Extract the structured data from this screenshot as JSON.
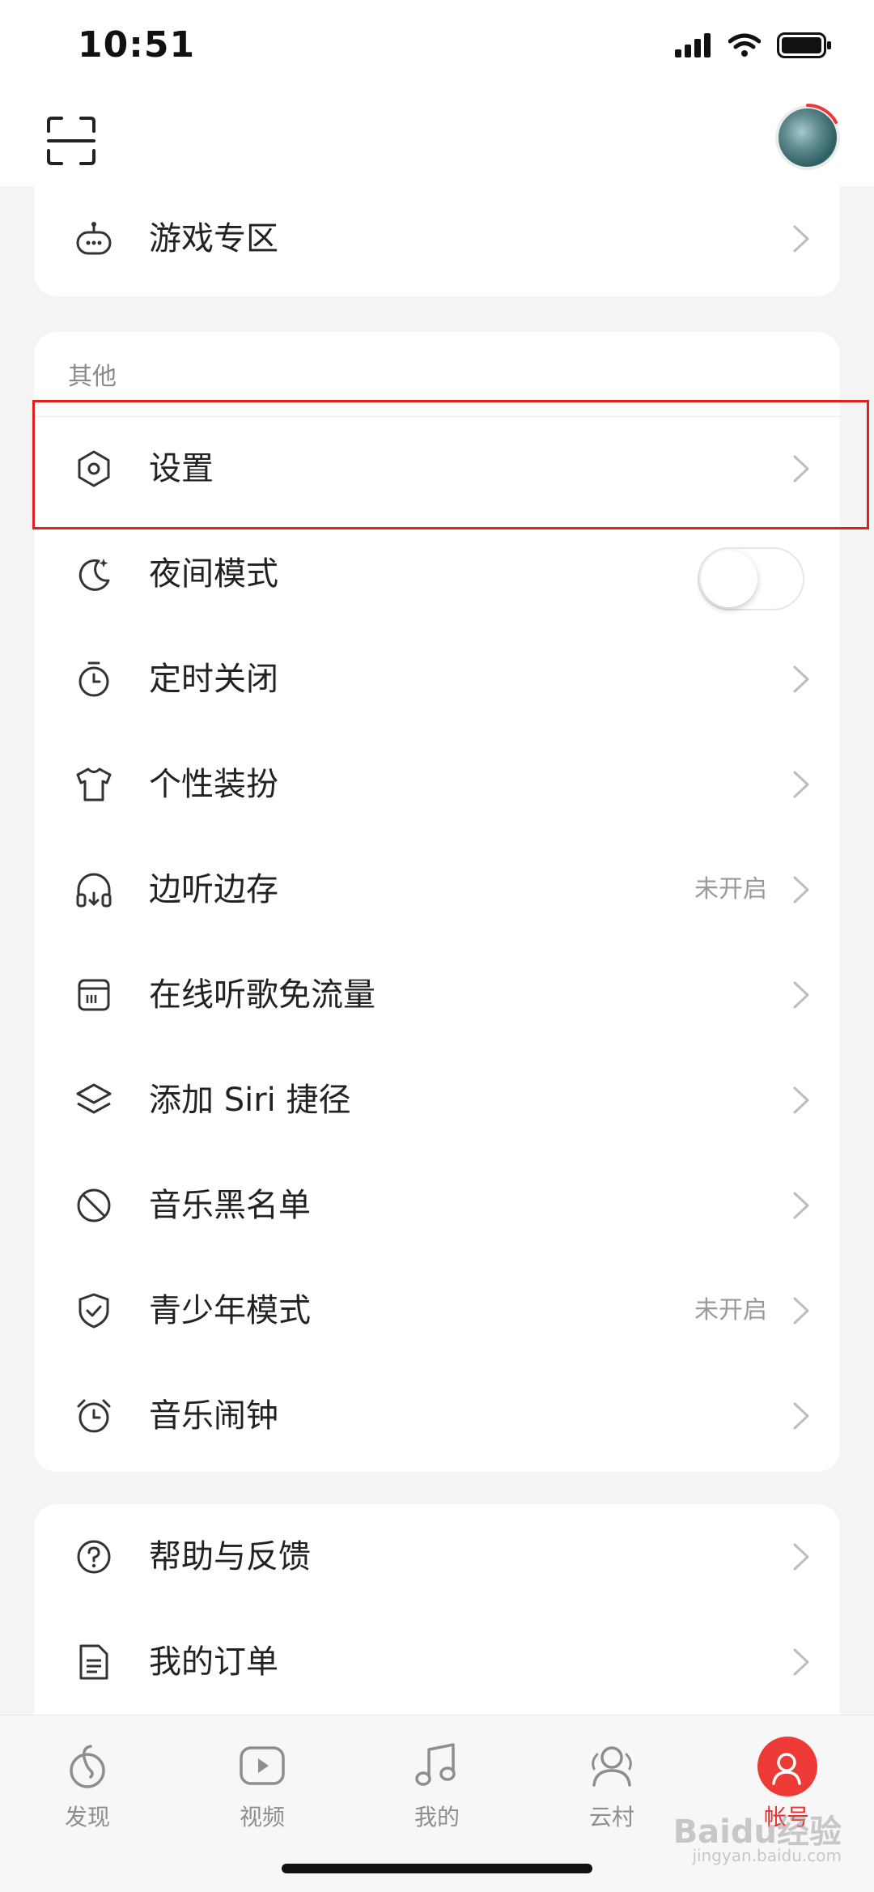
{
  "status_bar": {
    "time": "10:51"
  },
  "top_bar": {
    "scan_icon": "scan-icon",
    "avatar_icon": "avatar"
  },
  "card_top": {
    "items": [
      {
        "label": "游戏专区",
        "icon": "gamepad-icon"
      }
    ]
  },
  "other_section": {
    "title": "其他",
    "items": [
      {
        "label": "设置",
        "icon": "hexagon-settings-icon"
      },
      {
        "label": "夜间模式",
        "icon": "moon-icon",
        "toggle_on": false
      },
      {
        "label": "定时关闭",
        "icon": "timer-icon"
      },
      {
        "label": "个性装扮",
        "icon": "tshirt-icon"
      },
      {
        "label": "边听边存",
        "icon": "headphones-icon",
        "extra": "未开启"
      },
      {
        "label": "在线听歌免流量",
        "icon": "sim-card-icon"
      },
      {
        "label": "添加 Siri 捷径",
        "icon": "layers-icon"
      },
      {
        "label": "音乐黑名单",
        "icon": "block-icon"
      },
      {
        "label": "青少年模式",
        "icon": "shield-check-icon",
        "extra": "未开启"
      },
      {
        "label": "音乐闹钟",
        "icon": "alarm-icon"
      }
    ]
  },
  "card_bottom": {
    "items": [
      {
        "label": "帮助与反馈",
        "icon": "help-icon"
      },
      {
        "label": "我的订单",
        "icon": "document-icon"
      }
    ]
  },
  "tab_bar": {
    "tabs": [
      {
        "label": "发现",
        "icon": "discover-icon",
        "active": false
      },
      {
        "label": "视频",
        "icon": "video-icon",
        "active": false
      },
      {
        "label": "我的",
        "icon": "music-note-icon",
        "active": false
      },
      {
        "label": "云村",
        "icon": "community-icon",
        "active": false
      },
      {
        "label": "帐号",
        "icon": "account-icon",
        "active": true
      }
    ]
  },
  "colors": {
    "accent": "#ee3a36",
    "highlight_box": "#e0201f",
    "background": "#f4f4f5"
  },
  "watermark": {
    "text": "Baidu经验",
    "sub": "jingyan.baidu.com"
  }
}
